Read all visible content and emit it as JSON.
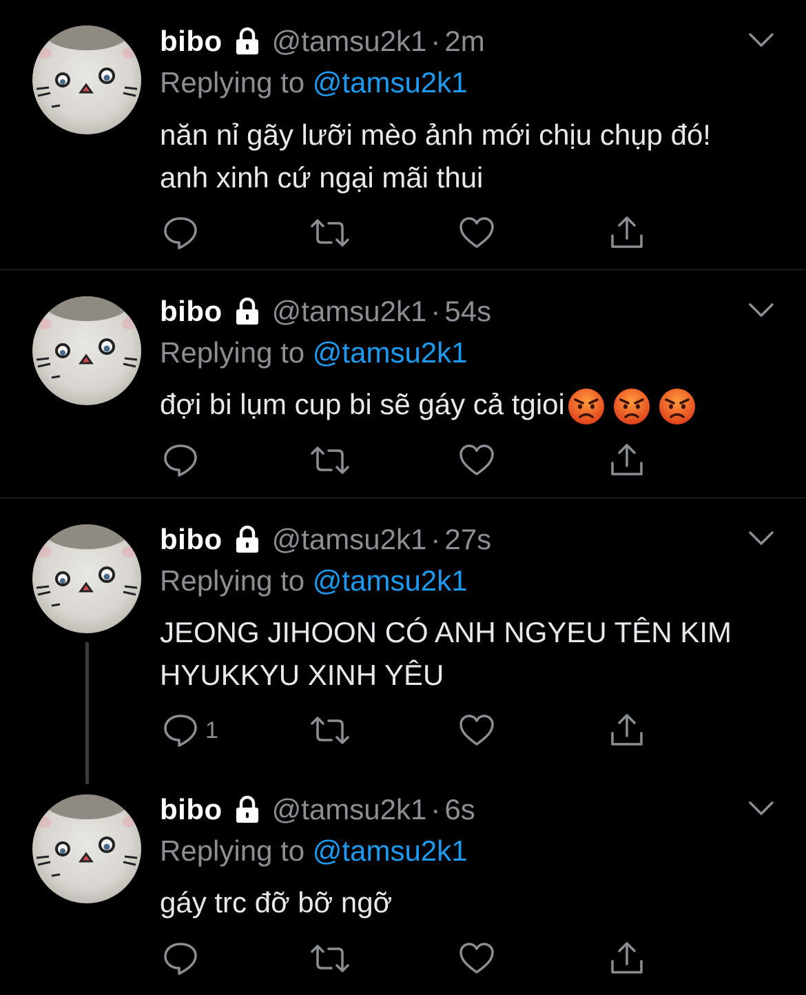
{
  "tweets": [
    {
      "display_name": "bibo",
      "handle": "@tamsu2k1",
      "separator": "·",
      "time": "2m",
      "replying_prefix": "Replying to",
      "replying_to": "@tamsu2k1",
      "text": "năn nỉ gãy lưỡi mèo ảnh mới chịu chụp đó! anh xinh cứ ngại mãi thui",
      "reply_count": ""
    },
    {
      "display_name": "bibo",
      "handle": "@tamsu2k1",
      "separator": "·",
      "time": "54s",
      "replying_prefix": "Replying to",
      "replying_to": "@tamsu2k1",
      "text": "đợi bi lụm cup bi sẽ gáy cả tgioi",
      "emojis": [
        "angry-face-icon",
        "angry-face-icon",
        "angry-face-icon"
      ],
      "reply_count": ""
    },
    {
      "display_name": "bibo",
      "handle": "@tamsu2k1",
      "separator": "·",
      "time": "27s",
      "replying_prefix": "Replying to",
      "replying_to": "@tamsu2k1",
      "text": "JEONG JIHOON CÓ ANH NGYEU TÊN KIM HYUKKYU XINH YÊU",
      "reply_count": "1"
    },
    {
      "display_name": "bibo",
      "handle": "@tamsu2k1",
      "separator": "·",
      "time": "6s",
      "replying_prefix": "Replying to",
      "replying_to": "@tamsu2k1",
      "text": "gáy trc đỡ bỡ ngỡ",
      "reply_count": ""
    }
  ],
  "icons": {
    "avatar": "cat-avatar",
    "lock": "lock-icon",
    "menu": "chevron-down-icon",
    "reply": "reply-icon",
    "retweet": "retweet-icon",
    "like": "heart-icon",
    "share": "share-icon"
  },
  "colors": {
    "background": "#000000",
    "text": "#e7e9ea",
    "muted": "#8b8f93",
    "link": "#1d9bf0",
    "divider": "#2f3336"
  }
}
